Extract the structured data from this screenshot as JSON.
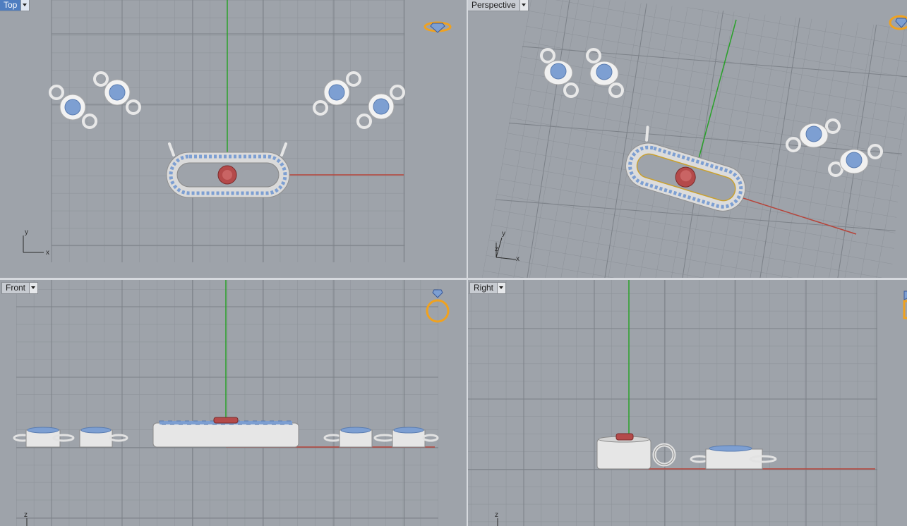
{
  "viewports": {
    "top": {
      "label": "Top",
      "active": true,
      "axes": [
        "y",
        "x"
      ]
    },
    "perspective": {
      "label": "Perspective",
      "active": false,
      "axes": [
        "y",
        "z",
        "x"
      ]
    },
    "front": {
      "label": "Front",
      "active": false,
      "axes": [
        "z"
      ]
    },
    "right": {
      "label": "Right",
      "active": false,
      "axes": [
        "z"
      ]
    }
  },
  "colors": {
    "background": "#9ea3aa",
    "grid": "#8c9198",
    "grid_major": "#7c8188",
    "x_axis": "#b6443a",
    "y_axis": "#2aa12a",
    "gem": "#7d9fd2",
    "metal": "#e6e6e6",
    "center_stone": "#c05252",
    "gumball_icon": "#f0a21f"
  },
  "icons": [
    "view-cube-icon",
    "ring-icon",
    "dropdown-arrow-icon"
  ]
}
